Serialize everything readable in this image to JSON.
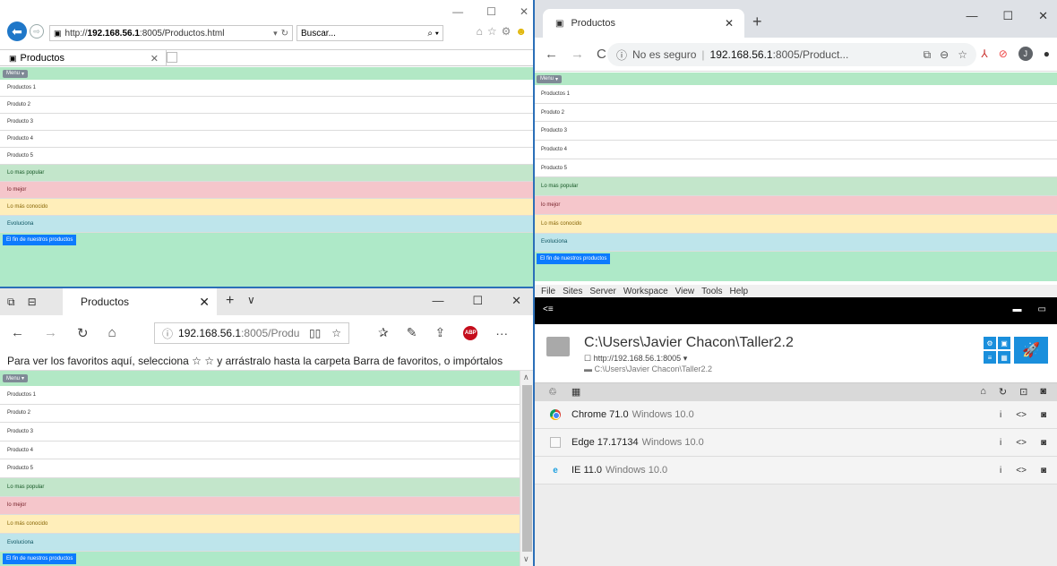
{
  "products": {
    "menu_label": "Menu",
    "items": [
      "Productos 1",
      "Produto 2",
      "Producto 3",
      "Producto 4",
      "Producto 5"
    ],
    "alerts": [
      {
        "label": "Lo mas popular",
        "variant": "green"
      },
      {
        "label": "lo mejor",
        "variant": "red"
      },
      {
        "label": "Lo más conocido",
        "variant": "yellow"
      },
      {
        "label": "Evoluciona",
        "variant": "blue"
      }
    ],
    "end_button": "El fin de nuestros productos"
  },
  "ie": {
    "url_prefix": "http://",
    "url_host": "192.168.56.1",
    "url_rest": ":8005/Productos.html",
    "search_placeholder": "Buscar...",
    "tab_title": "Productos"
  },
  "chrome": {
    "tab_title": "Productos",
    "security_text": "No es seguro",
    "url_host": "192.168.56.1",
    "url_rest": ":8005/Product...",
    "avatar_letter": "J"
  },
  "edge": {
    "tab_title": "Productos",
    "url_host": "192.168.56.1",
    "url_rest": ":8005/Produ",
    "favorites_hint": "Para ver los favoritos aquí, selecciona ☆ ☆ y arrástralo hasta la carpeta Barra de favoritos, o impórtalos"
  },
  "browsersync": {
    "menu": [
      "File",
      "Sites",
      "Server",
      "Workspace",
      "View",
      "Tools",
      "Help"
    ],
    "project_title": "C:\\Users\\Javier Chacon\\Taller2.2",
    "project_url": "http://192.168.56.1:8005",
    "project_path": "C:\\Users\\Javier Chacon\\Taller2.2",
    "browsers": [
      {
        "name": "Chrome 71.0",
        "os": "Windows 10.0",
        "icon": "chrome-icon"
      },
      {
        "name": "Edge 17.17134",
        "os": "Windows 10.0",
        "icon": "edge-icon"
      },
      {
        "name": "IE 11.0",
        "os": "Windows 10.0",
        "icon": "ie-icon"
      }
    ]
  }
}
